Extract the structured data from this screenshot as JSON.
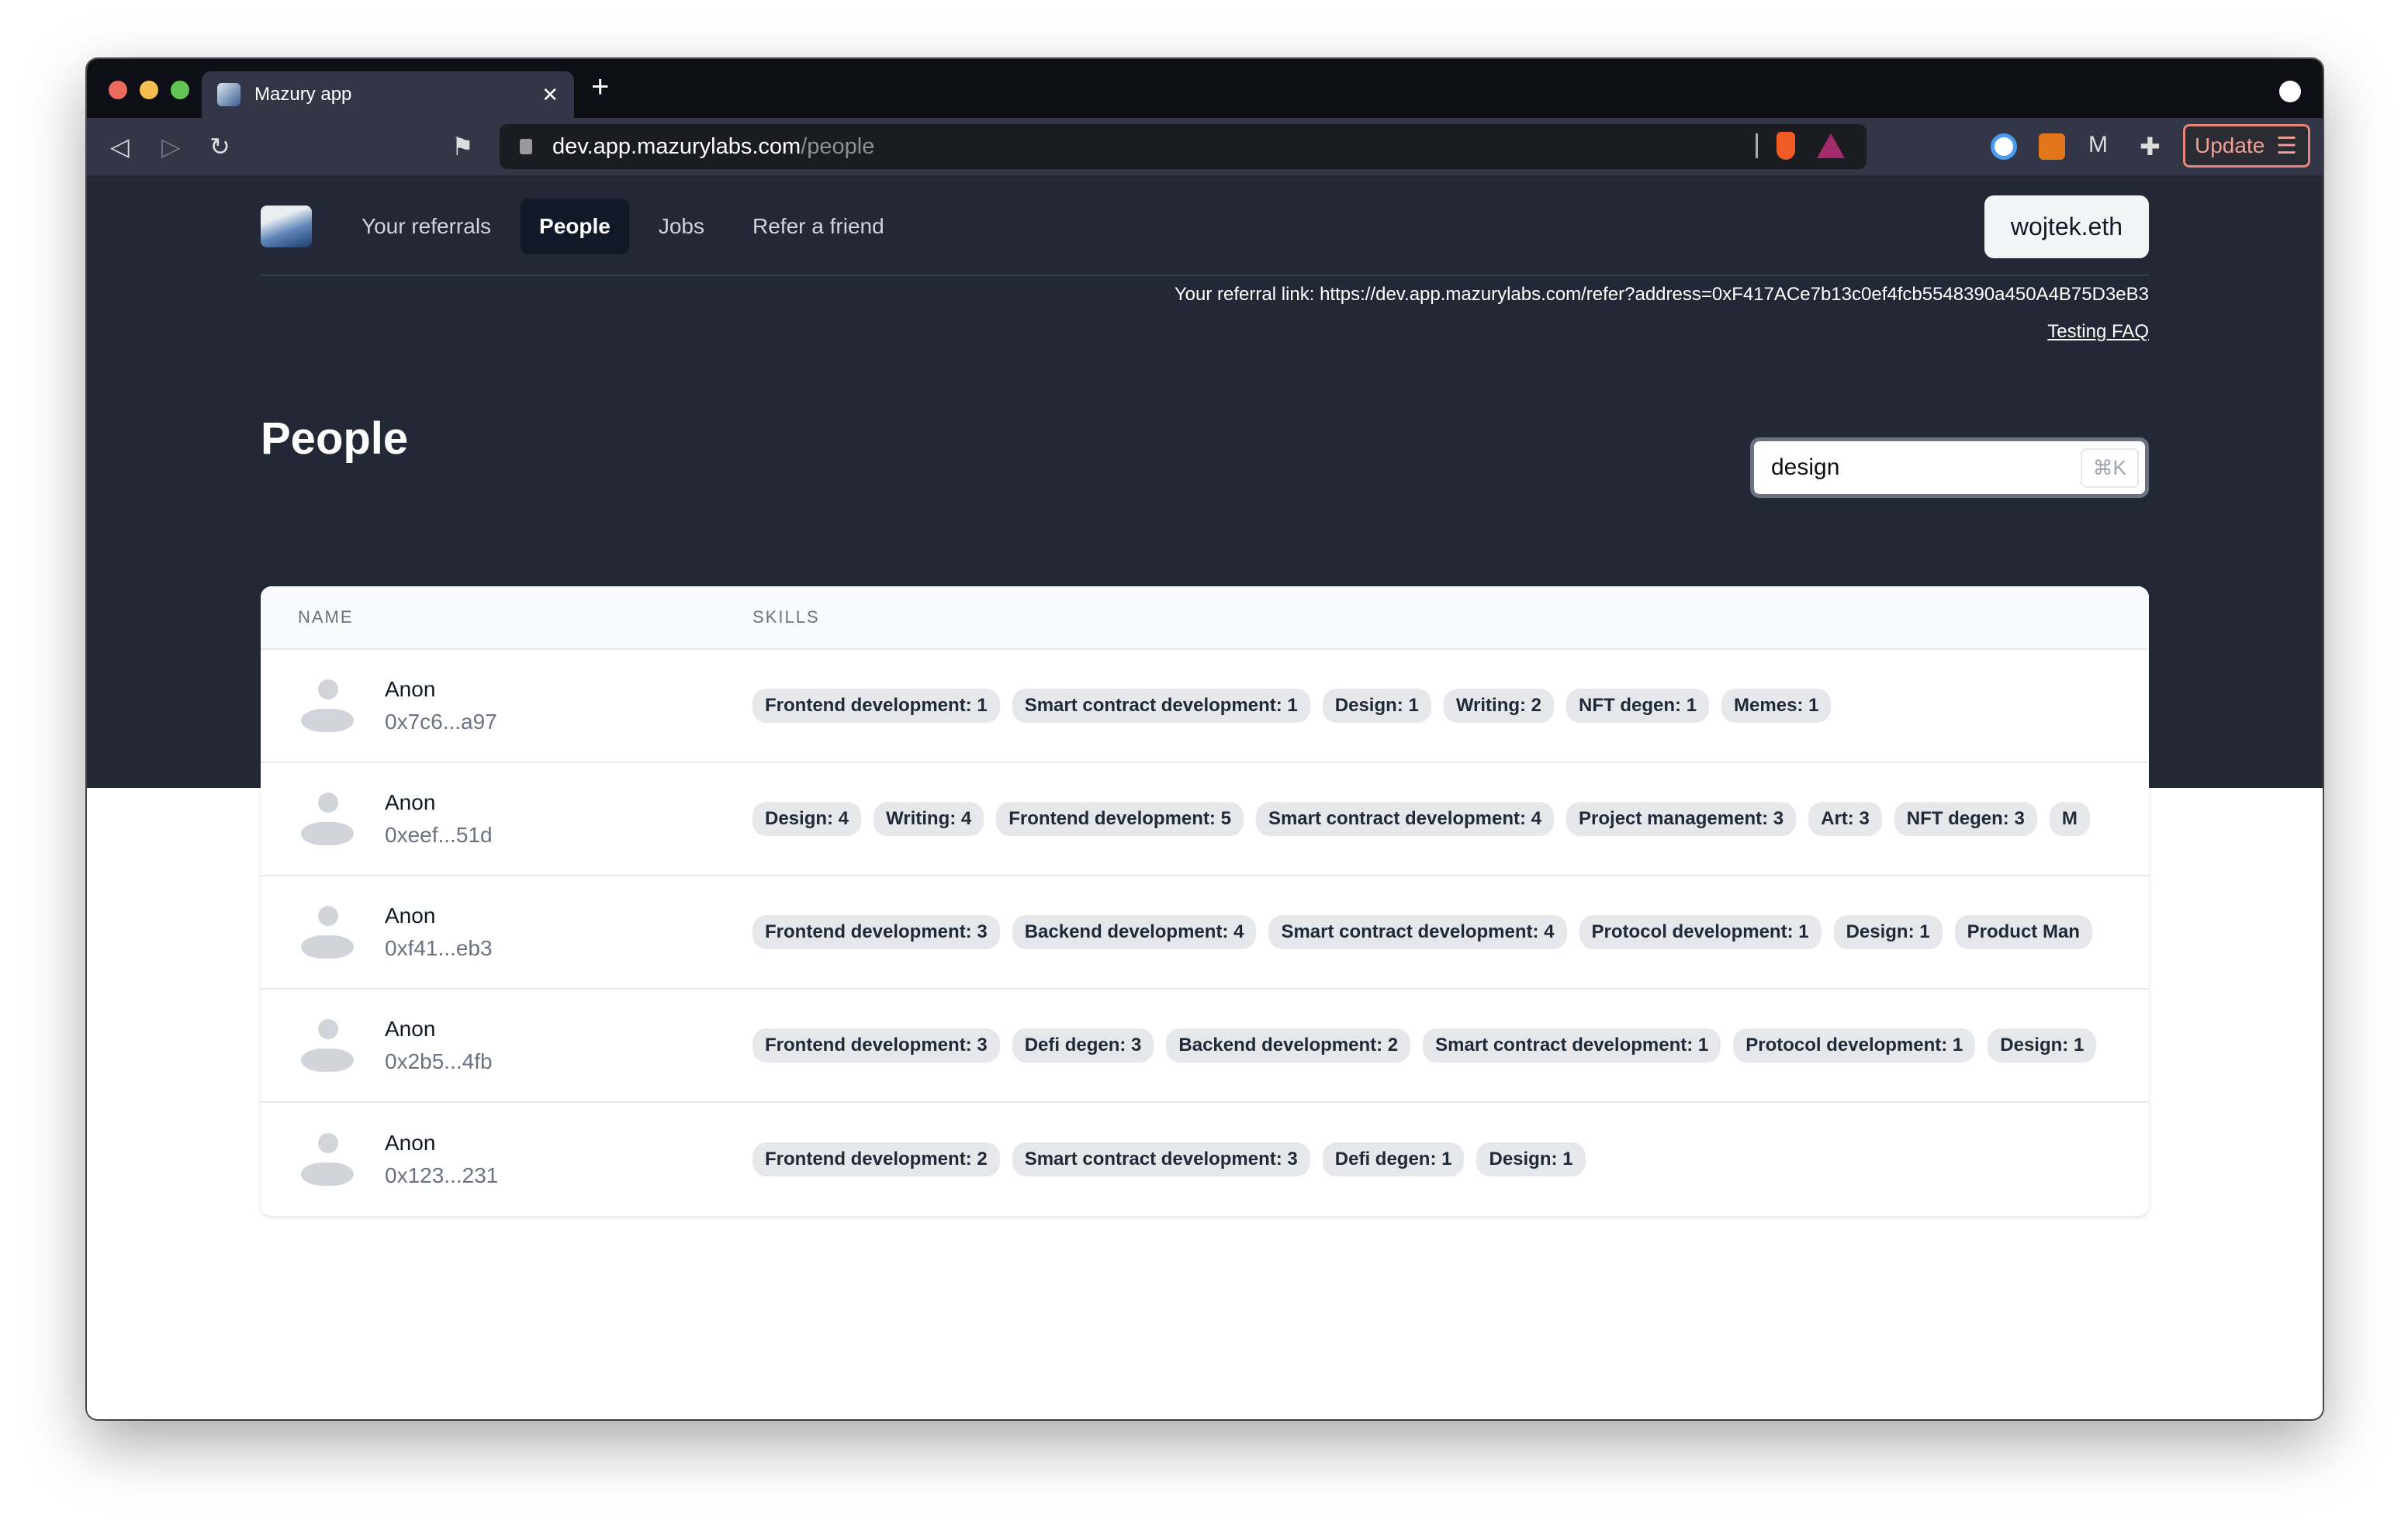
{
  "browser": {
    "tab_title": "Mazury app",
    "url_host": "dev.app.mazurylabs.com",
    "url_path": "/people",
    "update_label": "Update",
    "traffic_colors": [
      "#ed6a5e",
      "#f5bf4f",
      "#61c554"
    ]
  },
  "nav": {
    "links": [
      "Your referrals",
      "People",
      "Jobs",
      "Refer a friend"
    ],
    "active": "People",
    "wallet": "wojtek.eth"
  },
  "referral": {
    "text": "Your referral link: https://dev.app.mazurylabs.com/refer?address=0xF417ACe7b13c0ef4fcb5548390a450A4B75D3eB3",
    "faq": "Testing FAQ"
  },
  "page": {
    "title": "People",
    "search_value": "design",
    "search_shortcut": "⌘K"
  },
  "table": {
    "headers": [
      "NAME",
      "SKILLS"
    ],
    "rows": [
      {
        "name": "Anon",
        "address": "0x7c6...a97",
        "skills": [
          "Frontend development: 1",
          "Smart contract development: 1",
          "Design: 1",
          "Writing: 2",
          "NFT degen: 1",
          "Memes: 1"
        ]
      },
      {
        "name": "Anon",
        "address": "0xeef...51d",
        "skills": [
          "Design: 4",
          "Writing: 4",
          "Frontend development: 5",
          "Smart contract development: 4",
          "Project management: 3",
          "Art: 3",
          "NFT degen: 3",
          "M"
        ]
      },
      {
        "name": "Anon",
        "address": "0xf41...eb3",
        "skills": [
          "Frontend development: 3",
          "Backend development: 4",
          "Smart contract development: 4",
          "Protocol development: 1",
          "Design: 1",
          "Product Man"
        ]
      },
      {
        "name": "Anon",
        "address": "0x2b5...4fb",
        "skills": [
          "Frontend development: 3",
          "Defi degen: 3",
          "Backend development: 2",
          "Smart contract development: 1",
          "Protocol development: 1",
          "Design: 1"
        ]
      },
      {
        "name": "Anon",
        "address": "0x123...231",
        "skills": [
          "Frontend development: 2",
          "Smart contract development: 3",
          "Defi degen: 1",
          "Design: 1"
        ]
      }
    ]
  }
}
